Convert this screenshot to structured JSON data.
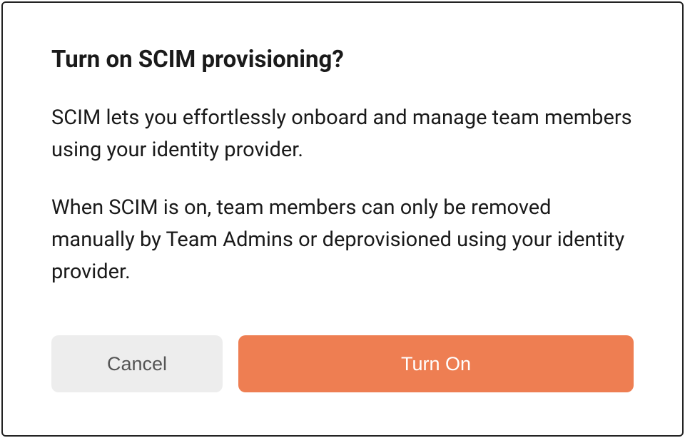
{
  "dialog": {
    "title": "Turn on SCIM provisioning?",
    "paragraphs": [
      "SCIM lets you effortlessly onboard and manage team members using your identity provider.",
      "When SCIM is on, team members can only be removed manually by Team Admins or deprovisioned using your identity provider."
    ],
    "actions": {
      "cancel_label": "Cancel",
      "confirm_label": "Turn On"
    }
  },
  "colors": {
    "primary": "#ee7e52",
    "secondary_bg": "#ededed",
    "text": "#1a1a1a",
    "muted_text": "#555"
  }
}
